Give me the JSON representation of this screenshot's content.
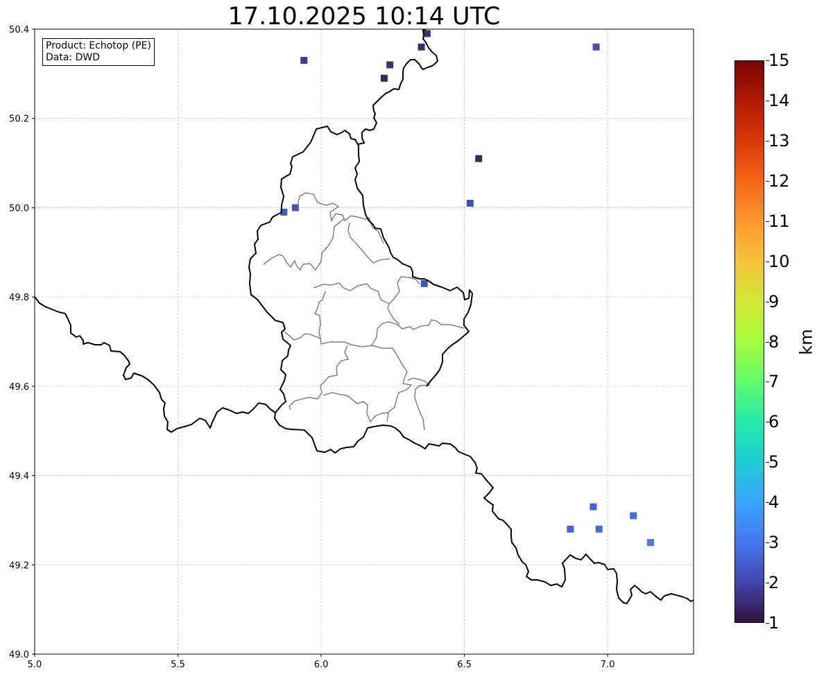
{
  "title": "17.10.2025 10:14 UTC",
  "info": {
    "product": "Product: Echotop (PE)",
    "data_source": "Data: DWD"
  },
  "axes": {
    "lon_ticks": [
      "5.0",
      "5.5",
      "6.0",
      "6.5",
      "7.0"
    ],
    "lat_ticks": [
      "50.4",
      "50.2",
      "50.0",
      "49.8",
      "49.6",
      "49.4",
      "49.2",
      "49.0"
    ],
    "lon_range": [
      5.0,
      7.3
    ],
    "lat_range": [
      49.0,
      50.4
    ],
    "grid": true
  },
  "colorbar": {
    "unit": "km",
    "min": 1,
    "max": 15,
    "ticks": [
      "15",
      "14",
      "13",
      "12",
      "11",
      "10",
      "9",
      "8",
      "7",
      "6",
      "5",
      "4",
      "3",
      "2",
      "1"
    ],
    "colormap": "turbo"
  },
  "colors": {
    "country_border": "#000000",
    "canton_border": "#808080",
    "echo_low": "#30123b",
    "echo_2km": "#4454c4",
    "echo_3km": "#4777ef"
  },
  "echo_cells": [
    {
      "lon": 6.35,
      "lat": 50.36,
      "km": 1.5
    },
    {
      "lon": 6.37,
      "lat": 50.39,
      "km": 1.6
    },
    {
      "lon": 6.24,
      "lat": 50.32,
      "km": 1.6
    },
    {
      "lon": 6.22,
      "lat": 50.29,
      "km": 1.4
    },
    {
      "lon": 5.94,
      "lat": 50.33,
      "km": 1.8
    },
    {
      "lon": 6.96,
      "lat": 50.36,
      "km": 2.2
    },
    {
      "lon": 6.55,
      "lat": 50.11,
      "km": 1.4
    },
    {
      "lon": 6.52,
      "lat": 50.01,
      "km": 2.2
    },
    {
      "lon": 5.87,
      "lat": 49.99,
      "km": 2.4
    },
    {
      "lon": 5.91,
      "lat": 50.0,
      "km": 2.3
    },
    {
      "lon": 6.36,
      "lat": 49.83,
      "km": 2.2
    },
    {
      "lon": 6.87,
      "lat": 49.28,
      "km": 2.6
    },
    {
      "lon": 6.95,
      "lat": 49.33,
      "km": 2.6
    },
    {
      "lon": 6.97,
      "lat": 49.28,
      "km": 2.7
    },
    {
      "lon": 7.09,
      "lat": 49.31,
      "km": 2.8
    },
    {
      "lon": 7.15,
      "lat": 49.25,
      "km": 3.0
    }
  ]
}
